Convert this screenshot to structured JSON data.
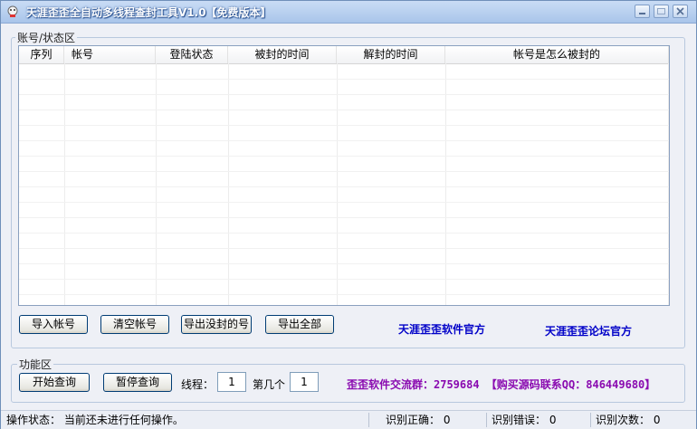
{
  "window": {
    "title": "天涯歪歪全自动多线程查封工具V1.0【免费版本】"
  },
  "account_group": {
    "title": "账号/状态区",
    "columns": [
      "序列",
      "帐号",
      "登陆状态",
      "被封的时间",
      "解封的时间",
      "帐号是怎么被封的"
    ],
    "rows": []
  },
  "actions": {
    "import_label": "导入帐号",
    "clear_label": "清空帐号",
    "export_unbanned_label": "导出没封的号",
    "export_all_label": "导出全部",
    "official_software_link": "天涯歪歪软件官方",
    "official_forum_link": "天涯歪歪论坛官方"
  },
  "function_group": {
    "title": "功能区",
    "start_label": "开始查询",
    "pause_label": "暂停查询",
    "threads_label": "线程：",
    "threads_value": "1",
    "nth_label": "第几个",
    "nth_value": "1",
    "promo_text": "歪歪软件交流群：2759684 【购买源码联系QQ：846449680】"
  },
  "status": {
    "operation_label": "操作状态：",
    "operation_text": "当前还未进行任何操作。",
    "correct_label": "识别正确：",
    "correct_value": "0",
    "error_label": "识别错误：",
    "error_value": "0",
    "count_label": "识别次数：",
    "count_value": "0"
  },
  "icons": [
    "app-icon",
    "minimize-icon",
    "maximize-icon",
    "close-icon"
  ]
}
